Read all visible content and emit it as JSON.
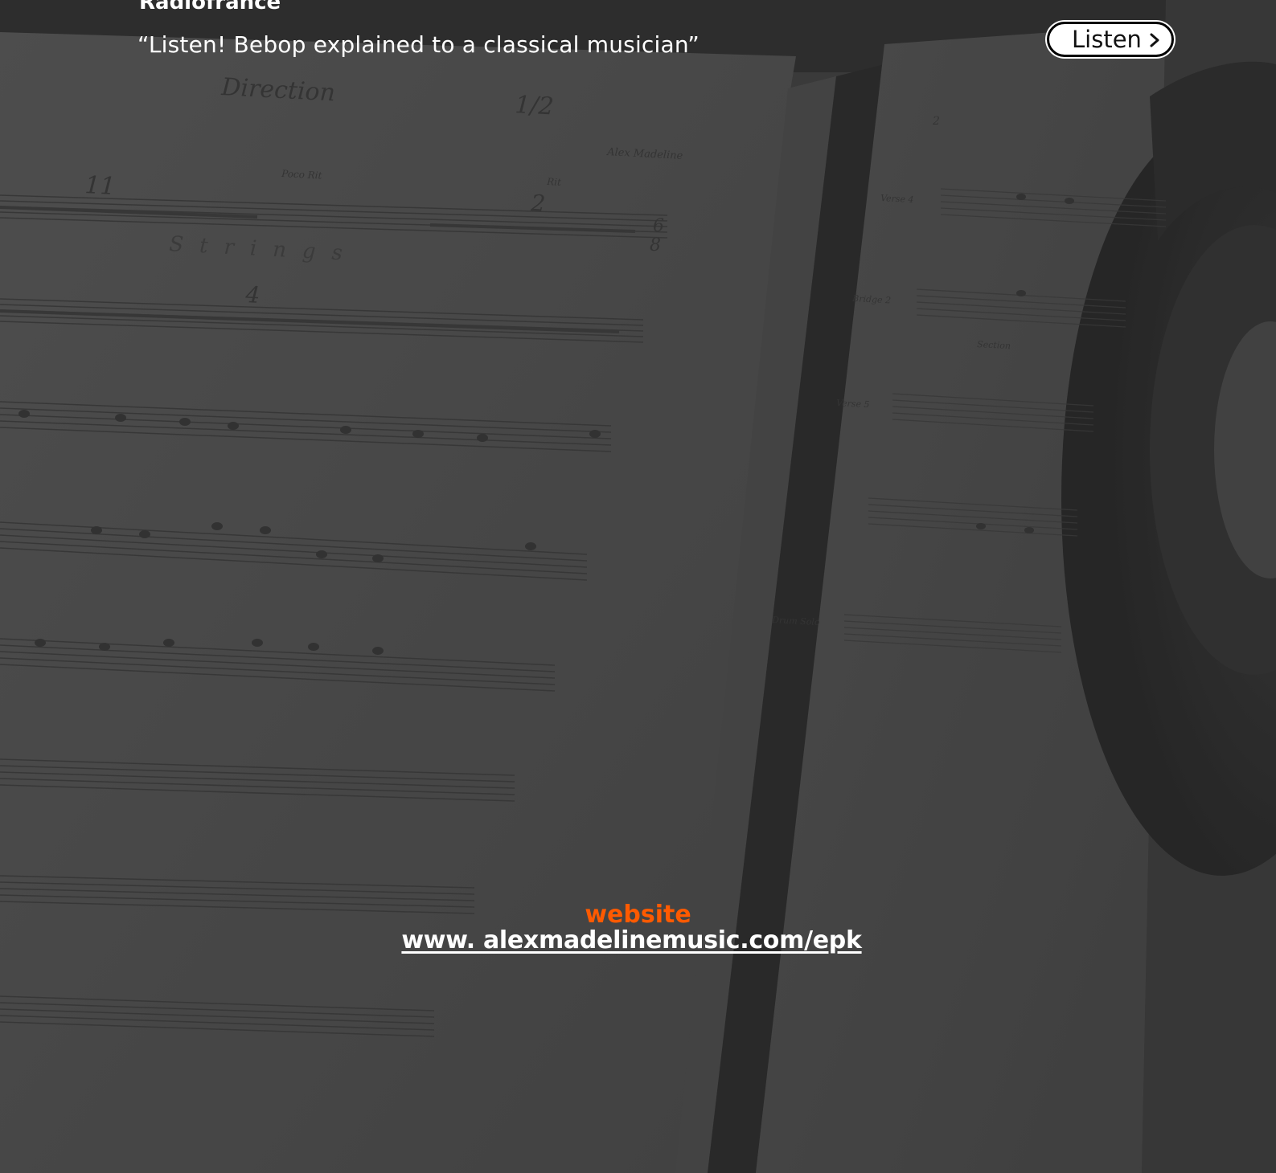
{
  "header": {
    "source": "Radiofrance",
    "quote": "“Listen! Bebop explained to a classical musician”"
  },
  "listen_button": {
    "label": "Listen",
    "icon": "chevron-right-icon"
  },
  "footer": {
    "label": "website",
    "link_text": "www. alexmadelinemusic.com/epk"
  },
  "colors": {
    "accent": "#ff5a00",
    "text": "#ffffff",
    "background": "#454545",
    "button_bg": "#ffffff",
    "button_border": "#000000"
  },
  "background_image": {
    "sheet_text": [
      "Direction",
      "1/2",
      "Alex Madeline",
      "Poco Rit",
      "Rit",
      "11",
      "2",
      "4",
      "6",
      "8",
      "Strings",
      "2",
      "Verse 4",
      "Bridge 2",
      "Verse 5",
      "Drum Solo",
      "Section"
    ]
  }
}
